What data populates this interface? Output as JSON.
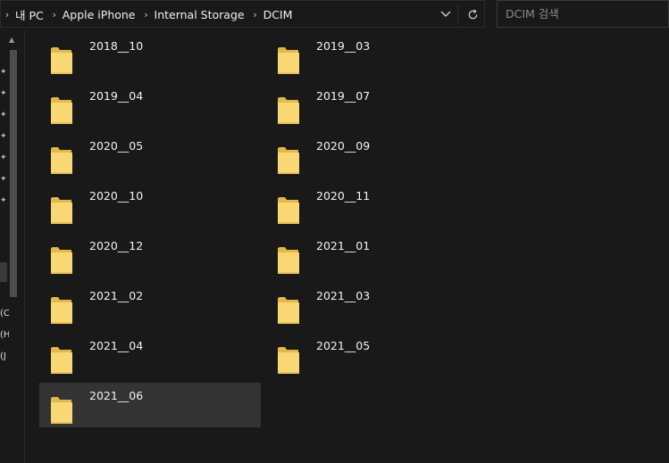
{
  "breadcrumb": {
    "items": [
      "내 PC",
      "Apple iPhone",
      "Internal Storage",
      "DCIM"
    ]
  },
  "search": {
    "placeholder": "DCIM 검색"
  },
  "nav": {
    "drive_labels": [
      "(C",
      "(H",
      "(J"
    ]
  },
  "folders": [
    {
      "name": "2018__10"
    },
    {
      "name": "2019__03"
    },
    {
      "name": "2019__04"
    },
    {
      "name": "2019__07"
    },
    {
      "name": "2020__05"
    },
    {
      "name": "2020__09"
    },
    {
      "name": "2020__10"
    },
    {
      "name": "2020__11"
    },
    {
      "name": "2020__12"
    },
    {
      "name": "2021__01"
    },
    {
      "name": "2021__02"
    },
    {
      "name": "2021__03"
    },
    {
      "name": "2021__04"
    },
    {
      "name": "2021__05"
    },
    {
      "name": "2021__06",
      "selected": true
    }
  ],
  "colors": {
    "background": "#191919",
    "folder_yellow": "#f8d775",
    "folder_dark": "#e3b84a",
    "selection": "#333333"
  }
}
